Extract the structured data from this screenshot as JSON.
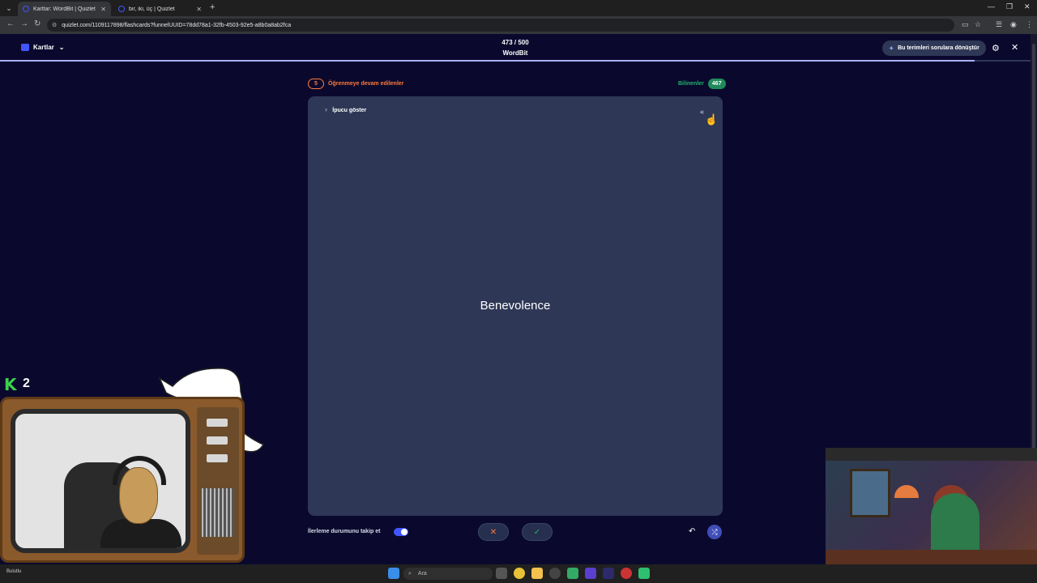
{
  "browser": {
    "tabs": [
      {
        "title": "Kartlar: WordBit | Quizlet",
        "active": true
      },
      {
        "title": "bir, iki, üç | Quizlet",
        "active": false
      }
    ],
    "url": "quizlet.com/1109117898/flashcards?funnelUUID=78dd78a1-32fb-4503-92e5-a8b0a8ab2fca"
  },
  "header": {
    "mode_label": "Kartlar",
    "progress_text": "473 / 500",
    "progress_fraction": 0.946,
    "set_title": "WordBit",
    "convert_label": "Bu terimleri sorulara dönüştür"
  },
  "counters": {
    "learning_count": "5",
    "learning_label": "Öğrenmeye devam edilenler",
    "known_label": "Bilinenler",
    "known_count": "467"
  },
  "card": {
    "hint_label": "İpucu göster",
    "term": "Benevolence"
  },
  "controls": {
    "track_progress_label": "İlerleme durumunu takip et",
    "track_progress_on": true
  },
  "overlay": {
    "k_count": "2"
  },
  "taskbar": {
    "search_placeholder": "Ara",
    "weather_text": "Bulutlu"
  },
  "colors": {
    "background": "#0a092d",
    "card": "#2e3856",
    "accent": "#4255ff",
    "learning": "#ff7a3d",
    "known": "#23b26d"
  },
  "icons": [
    "tab-list-icon",
    "back-icon",
    "forward-icon",
    "reload-icon",
    "site-info-icon",
    "install-icon",
    "star-icon",
    "sidepanel-icon",
    "profile-icon",
    "menu-icon",
    "cards-icon",
    "chevron-down-icon",
    "sparkle-icon",
    "gear-icon",
    "close-icon",
    "bulb-icon",
    "audio-icon",
    "x-icon",
    "check-icon",
    "undo-icon",
    "shuffle-icon",
    "windows-start-icon",
    "search-icon"
  ]
}
